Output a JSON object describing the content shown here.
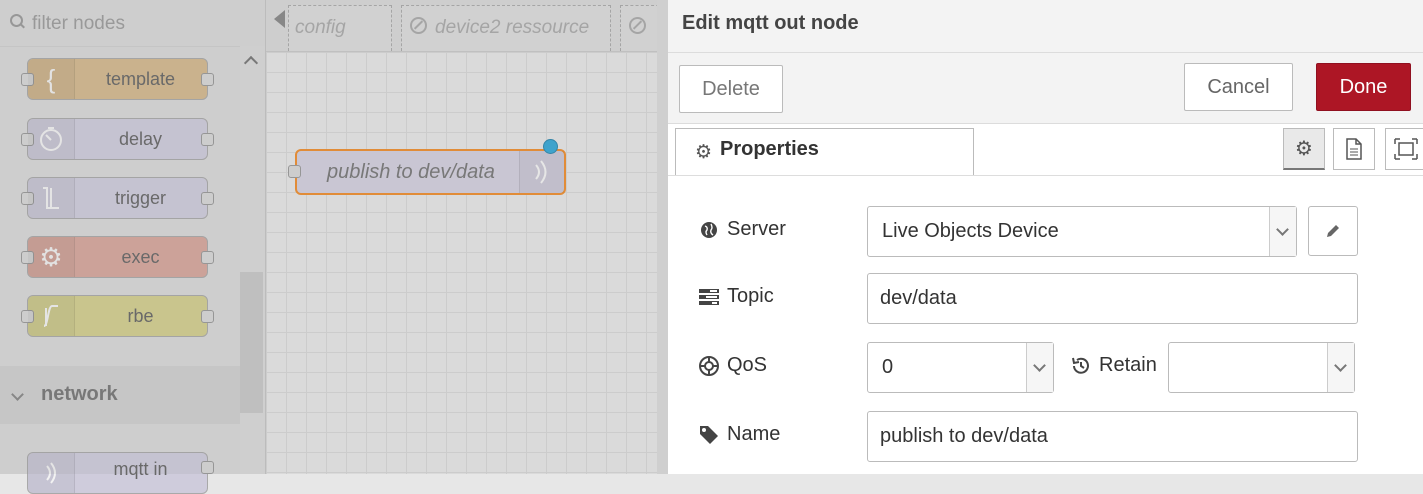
{
  "palette": {
    "filter_placeholder": "filter nodes",
    "nodes": [
      {
        "label": "template",
        "color": "#DEB887"
      },
      {
        "label": "delay",
        "color": "#E6E0F8"
      },
      {
        "label": "trigger",
        "color": "#E6E0F8"
      },
      {
        "label": "exec",
        "color": "#E2D96E"
      },
      {
        "label": "rbe",
        "color": "#E2D96E"
      }
    ],
    "category": "network",
    "partial_node": "mqtt in"
  },
  "workspace": {
    "tabs": [
      {
        "label": "config",
        "disabled": false
      },
      {
        "label": "device2 ressource",
        "disabled": true
      },
      {
        "label": "",
        "disabled": true
      }
    ],
    "flow_node": {
      "label": "publish to dev/data",
      "selected_color": "#EE8E2E",
      "changed_dot_color": "#36A8D6"
    }
  },
  "editor": {
    "title": "Edit mqtt out node",
    "delete_label": "Delete",
    "cancel_label": "Cancel",
    "done_label": "Done",
    "done_color": "#AD1625",
    "tab_label": "Properties",
    "fields": {
      "server": {
        "label": "Server",
        "value": "Live Objects Device"
      },
      "topic": {
        "label": "Topic",
        "value": "dev/data"
      },
      "qos": {
        "label": "QoS",
        "value": "0"
      },
      "retain": {
        "label": "Retain",
        "value": ""
      },
      "name": {
        "label": "Name",
        "value": "publish to dev/data"
      }
    }
  }
}
